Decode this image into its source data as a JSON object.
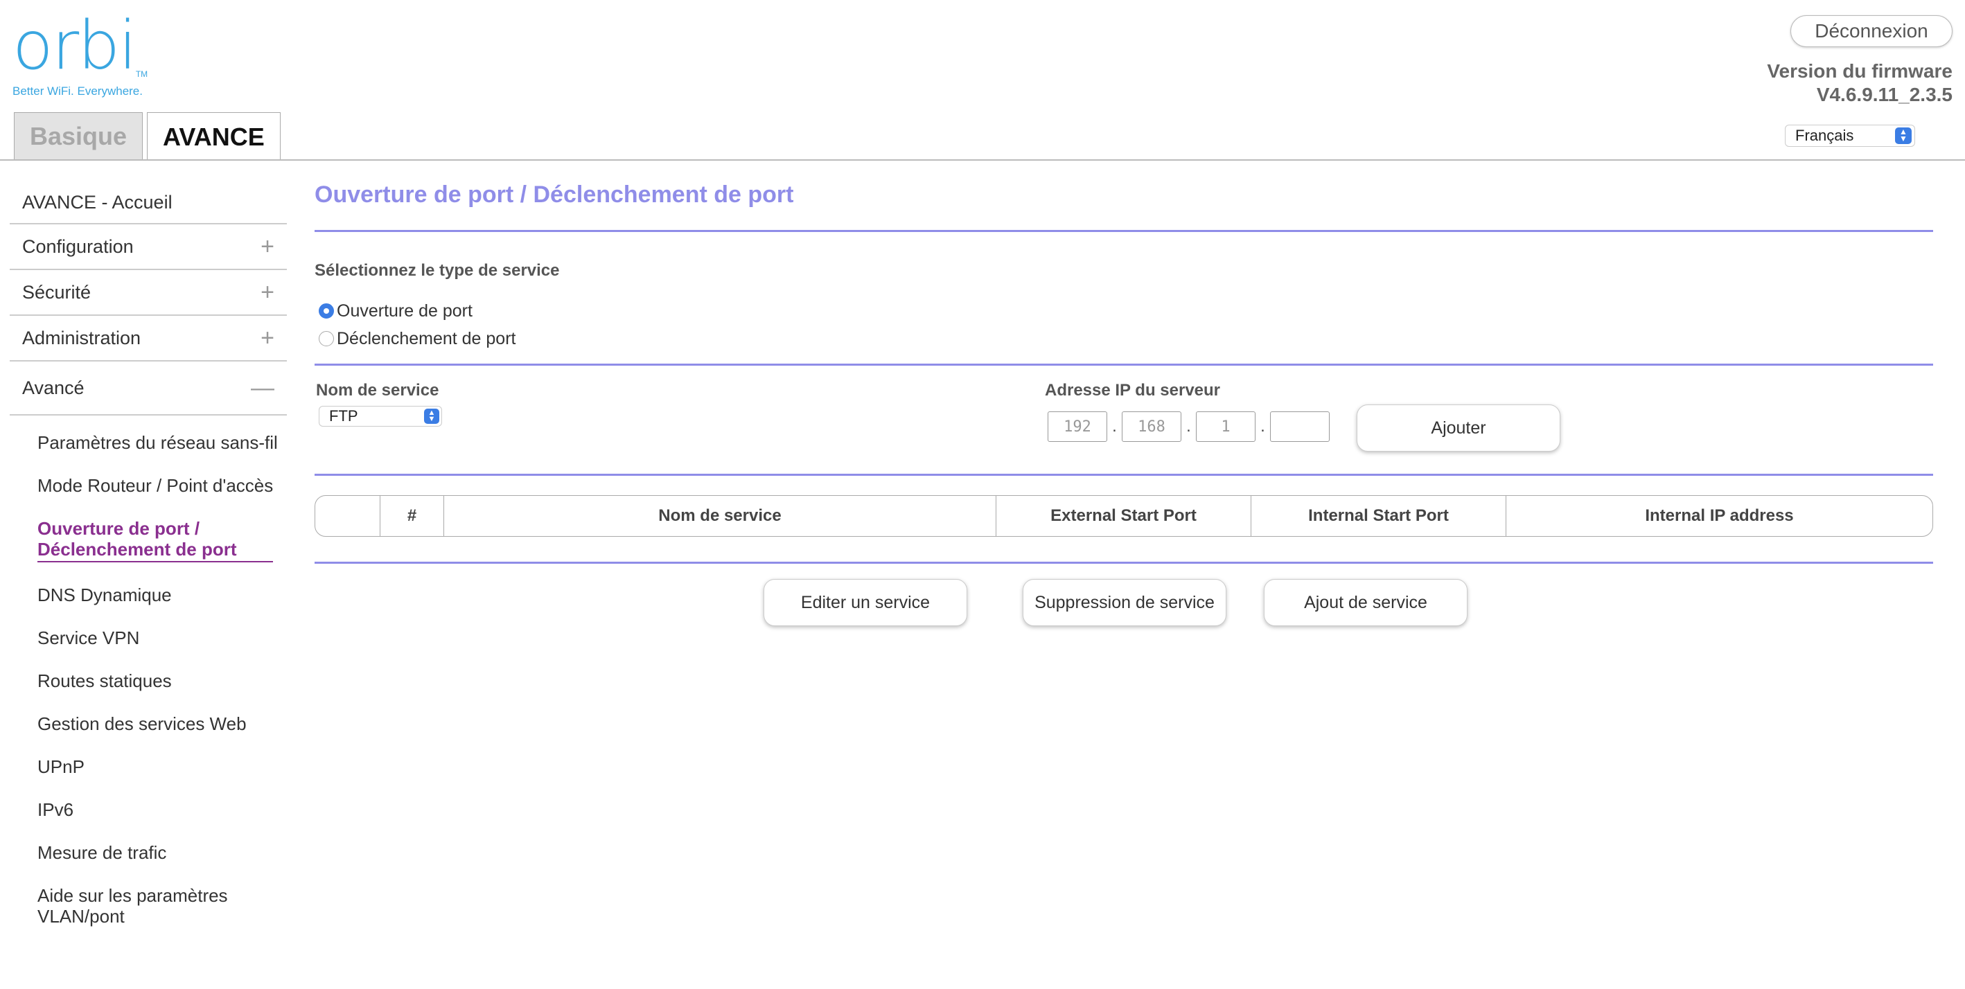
{
  "header": {
    "logo_text": "orbi",
    "logo_tm": "TM",
    "logo_tagline": "Better WiFi. Everywhere.",
    "logout_label": "Déconnexion",
    "firmware_label": "Version du firmware",
    "firmware_version": "V4.6.9.11_2.3.5",
    "language": "Français"
  },
  "tabs": [
    {
      "label": "Basique",
      "active": false
    },
    {
      "label": "AVANCE",
      "active": true
    }
  ],
  "sidebar": {
    "main_items": [
      {
        "label": "AVANCE - Accueil",
        "toggle": ""
      },
      {
        "label": "Configuration",
        "toggle": "+"
      },
      {
        "label": "Sécurité",
        "toggle": "+"
      },
      {
        "label": "Administration",
        "toggle": "+"
      },
      {
        "label": "Avancé",
        "toggle": "—"
      }
    ],
    "sub_items": [
      {
        "label": "Paramètres du réseau sans-fil"
      },
      {
        "label": "Mode Routeur / Point d'accès"
      },
      {
        "label": "Ouverture de port / Déclenchement de port",
        "active": true
      },
      {
        "label": "DNS Dynamique"
      },
      {
        "label": "Service VPN"
      },
      {
        "label": "Routes statiques"
      },
      {
        "label": "Gestion des services Web"
      },
      {
        "label": "UPnP"
      },
      {
        "label": "IPv6"
      },
      {
        "label": "Mesure de trafic"
      },
      {
        "label": "Aide sur les paramètres VLAN/pont"
      }
    ]
  },
  "main": {
    "title": "Ouverture de port / Déclenchement de port",
    "service_type_label": "Sélectionnez le type de service",
    "radio_options": [
      {
        "label": "Ouverture de port",
        "checked": true
      },
      {
        "label": "Déclenchement de port",
        "checked": false
      }
    ],
    "service_name_label": "Nom de service",
    "service_name_value": "FTP",
    "server_ip_label": "Adresse IP du serveur",
    "ip_placeholders": [
      "192",
      "168",
      "1",
      ""
    ],
    "add_button": "Ajouter",
    "table_headers": [
      "",
      "#",
      "Nom de service",
      "External Start Port",
      "Internal Start Port",
      "Internal IP address"
    ],
    "buttons": {
      "edit": "Editer un service",
      "delete": "Suppression de service",
      "add_service": "Ajout de service"
    }
  },
  "colors": {
    "accent_purple": "#8f8de8",
    "active_link": "#8a2f8f",
    "logo_blue": "#3aa6e0",
    "control_blue": "#3b7de4"
  }
}
